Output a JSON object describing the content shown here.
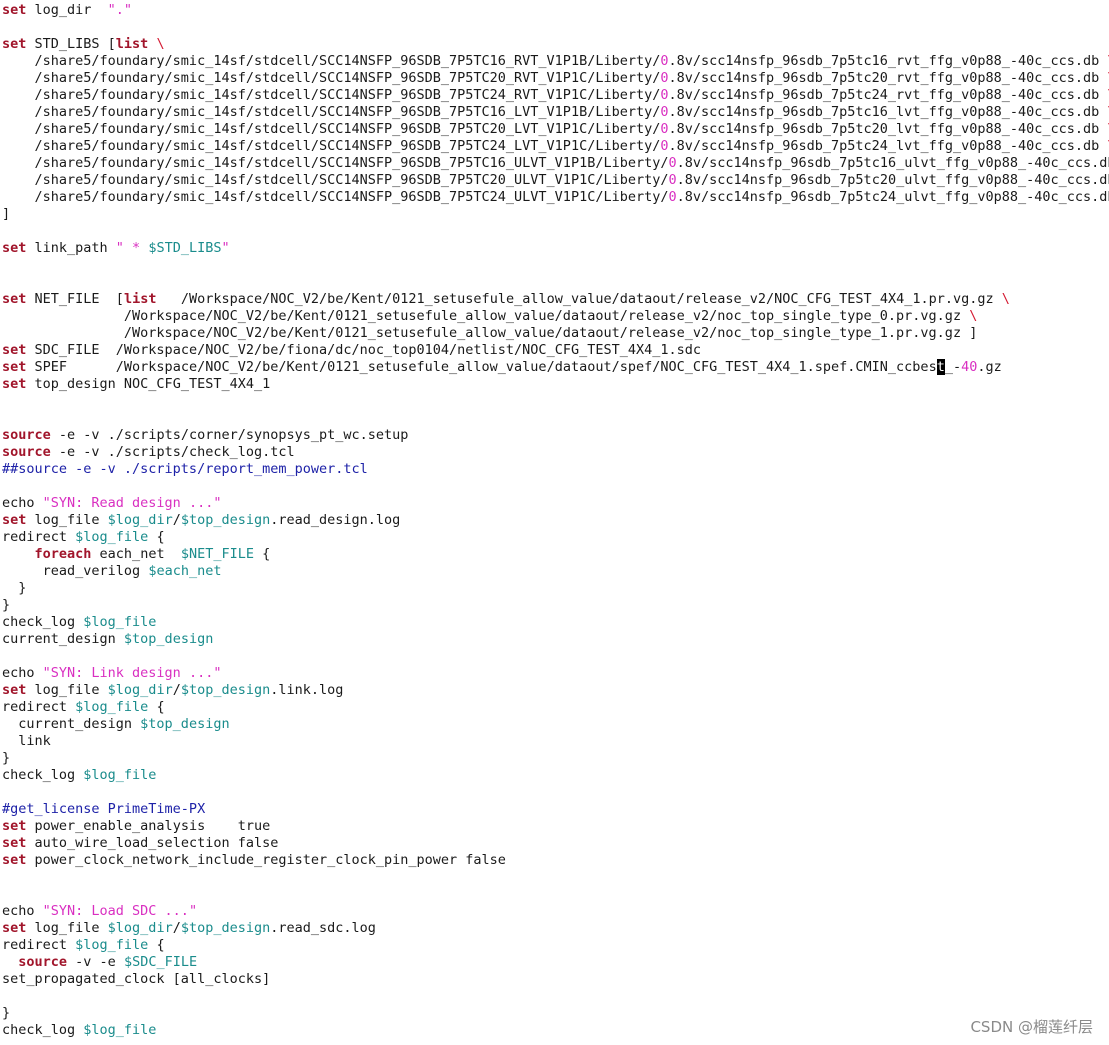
{
  "editor": {
    "lines": [
      [
        [
          "kw",
          "set"
        ],
        [
          "t",
          " log_dir  "
        ],
        [
          "str",
          "\".\""
        ]
      ],
      [],
      [
        [
          "kw",
          "set"
        ],
        [
          "t",
          " STD_LIBS ["
        ],
        [
          "kw",
          "list"
        ],
        [
          "t",
          " "
        ],
        [
          "esc",
          "\\"
        ]
      ],
      [
        [
          "t",
          "    /share5/foundary/smic_14sf/stdcell/SCC14NSFP_96SDB_7P5TC16_RVT_V1P1B/Liberty/"
        ],
        [
          "num",
          "0"
        ],
        [
          "t",
          ".8v/scc14nsfp_96sdb_7p5tc16_rvt_ffg_v0p88_-40c_ccs.db "
        ],
        [
          "esc",
          "\\"
        ]
      ],
      [
        [
          "t",
          "    /share5/foundary/smic_14sf/stdcell/SCC14NSFP_96SDB_7P5TC20_RVT_V1P1C/Liberty/"
        ],
        [
          "num",
          "0"
        ],
        [
          "t",
          ".8v/scc14nsfp_96sdb_7p5tc20_rvt_ffg_v0p88_-40c_ccs.db "
        ],
        [
          "esc",
          "\\"
        ]
      ],
      [
        [
          "t",
          "    /share5/foundary/smic_14sf/stdcell/SCC14NSFP_96SDB_7P5TC24_RVT_V1P1C/Liberty/"
        ],
        [
          "num",
          "0"
        ],
        [
          "t",
          ".8v/scc14nsfp_96sdb_7p5tc24_rvt_ffg_v0p88_-40c_ccs.db "
        ],
        [
          "esc",
          "\\"
        ]
      ],
      [
        [
          "t",
          "    /share5/foundary/smic_14sf/stdcell/SCC14NSFP_96SDB_7P5TC16_LVT_V1P1B/Liberty/"
        ],
        [
          "num",
          "0"
        ],
        [
          "t",
          ".8v/scc14nsfp_96sdb_7p5tc16_lvt_ffg_v0p88_-40c_ccs.db "
        ],
        [
          "esc",
          "\\"
        ]
      ],
      [
        [
          "t",
          "    /share5/foundary/smic_14sf/stdcell/SCC14NSFP_96SDB_7P5TC20_LVT_V1P1C/Liberty/"
        ],
        [
          "num",
          "0"
        ],
        [
          "t",
          ".8v/scc14nsfp_96sdb_7p5tc20_lvt_ffg_v0p88_-40c_ccs.db "
        ],
        [
          "esc",
          "\\"
        ]
      ],
      [
        [
          "t",
          "    /share5/foundary/smic_14sf/stdcell/SCC14NSFP_96SDB_7P5TC24_LVT_V1P1C/Liberty/"
        ],
        [
          "num",
          "0"
        ],
        [
          "t",
          ".8v/scc14nsfp_96sdb_7p5tc24_lvt_ffg_v0p88_-40c_ccs.db "
        ],
        [
          "esc",
          "\\"
        ]
      ],
      [
        [
          "t",
          "    /share5/foundary/smic_14sf/stdcell/SCC14NSFP_96SDB_7P5TC16_ULVT_V1P1B/Liberty/"
        ],
        [
          "num",
          "0"
        ],
        [
          "t",
          ".8v/scc14nsfp_96sdb_7p5tc16_ulvt_ffg_v0p88_-40c_ccs.db "
        ],
        [
          "esc",
          "\\"
        ]
      ],
      [
        [
          "t",
          "    /share5/foundary/smic_14sf/stdcell/SCC14NSFP_96SDB_7P5TC20_ULVT_V1P1C/Liberty/"
        ],
        [
          "num",
          "0"
        ],
        [
          "t",
          ".8v/scc14nsfp_96sdb_7p5tc20_ulvt_ffg_v0p88_-40c_ccs.db "
        ],
        [
          "esc",
          "\\"
        ]
      ],
      [
        [
          "t",
          "    /share5/foundary/smic_14sf/stdcell/SCC14NSFP_96SDB_7P5TC24_ULVT_V1P1C/Liberty/"
        ],
        [
          "num",
          "0"
        ],
        [
          "t",
          ".8v/scc14nsfp_96sdb_7p5tc24_ulvt_ffg_v0p88_-40c_ccs.db "
        ],
        [
          "esc",
          "\\"
        ]
      ],
      [
        [
          "t",
          "]"
        ]
      ],
      [],
      [
        [
          "kw",
          "set"
        ],
        [
          "t",
          " link_path "
        ],
        [
          "str",
          "\" * "
        ],
        [
          "var",
          "$STD_LIBS"
        ],
        [
          "str",
          "\""
        ]
      ],
      [],
      [],
      [
        [
          "kw",
          "set"
        ],
        [
          "t",
          " NET_FILE  ["
        ],
        [
          "kw",
          "list"
        ],
        [
          "t",
          "   /Workspace/NOC_V2/be/Kent/0121_setusefule_allow_value/dataout/release_v2/NOC_CFG_TEST_4X4_1.pr.vg.gz "
        ],
        [
          "esc",
          "\\"
        ]
      ],
      [
        [
          "t",
          "               /Workspace/NOC_V2/be/Kent/0121_setusefule_allow_value/dataout/release_v2/noc_top_single_type_0.pr.vg.gz "
        ],
        [
          "esc",
          "\\"
        ]
      ],
      [
        [
          "t",
          "               /Workspace/NOC_V2/be/Kent/0121_setusefule_allow_value/dataout/release_v2/noc_top_single_type_1.pr.vg.gz ]"
        ]
      ],
      [
        [
          "kw",
          "set"
        ],
        [
          "t",
          " SDC_FILE  /Workspace/NOC_V2/be/fiona/dc/noc_top0104/netlist/NOC_CFG_TEST_4X4_1.sdc"
        ]
      ],
      [
        [
          "kw",
          "set"
        ],
        [
          "t",
          " SPEF      /Workspace/NOC_V2/be/Kent/0121_setusefule_allow_value/dataout/spef/NOC_CFG_TEST_4X4_1.spef.CMIN_ccbes"
        ],
        [
          "cursor",
          "t"
        ],
        [
          "t",
          "_-"
        ],
        [
          "num",
          "40"
        ],
        [
          "t",
          ".gz"
        ]
      ],
      [
        [
          "kw",
          "set"
        ],
        [
          "t",
          " top_design NOC_CFG_TEST_4X4_1"
        ]
      ],
      [],
      [],
      [
        [
          "kw",
          "source"
        ],
        [
          "t",
          " -e -v ./scripts/corner/synopsys_pt_wc.setup"
        ]
      ],
      [
        [
          "kw",
          "source"
        ],
        [
          "t",
          " -e -v ./scripts/check_log.tcl"
        ]
      ],
      [
        [
          "cmt",
          "##source -e -v ./scripts/report_mem_power.tcl"
        ]
      ],
      [],
      [
        [
          "t",
          "echo "
        ],
        [
          "str",
          "\"SYN: Read design ...\""
        ]
      ],
      [
        [
          "kw",
          "set"
        ],
        [
          "t",
          " log_file "
        ],
        [
          "var",
          "$log_dir"
        ],
        [
          "t",
          "/"
        ],
        [
          "var",
          "$top_design"
        ],
        [
          "t",
          ".read_design.log"
        ]
      ],
      [
        [
          "t",
          "redirect "
        ],
        [
          "var",
          "$log_file"
        ],
        [
          "t",
          " {"
        ]
      ],
      [
        [
          "t",
          "    "
        ],
        [
          "kw",
          "foreach"
        ],
        [
          "t",
          " each_net  "
        ],
        [
          "var",
          "$NET_FILE"
        ],
        [
          "t",
          " {"
        ]
      ],
      [
        [
          "t",
          "     read_verilog "
        ],
        [
          "var",
          "$each_net"
        ]
      ],
      [
        [
          "t",
          "  }"
        ]
      ],
      [
        [
          "t",
          "}"
        ]
      ],
      [
        [
          "t",
          "check_log "
        ],
        [
          "var",
          "$log_file"
        ]
      ],
      [
        [
          "t",
          "current_design "
        ],
        [
          "var",
          "$top_design"
        ]
      ],
      [],
      [
        [
          "t",
          "echo "
        ],
        [
          "str",
          "\"SYN: Link design ...\""
        ]
      ],
      [
        [
          "kw",
          "set"
        ],
        [
          "t",
          " log_file "
        ],
        [
          "var",
          "$log_dir"
        ],
        [
          "t",
          "/"
        ],
        [
          "var",
          "$top_design"
        ],
        [
          "t",
          ".link.log"
        ]
      ],
      [
        [
          "t",
          "redirect "
        ],
        [
          "var",
          "$log_file"
        ],
        [
          "t",
          " {"
        ]
      ],
      [
        [
          "t",
          "  current_design "
        ],
        [
          "var",
          "$top_design"
        ]
      ],
      [
        [
          "t",
          "  link"
        ]
      ],
      [
        [
          "t",
          "}"
        ]
      ],
      [
        [
          "t",
          "check_log "
        ],
        [
          "var",
          "$log_file"
        ]
      ],
      [],
      [
        [
          "cmt",
          "#get_license PrimeTime-PX"
        ]
      ],
      [
        [
          "kw",
          "set"
        ],
        [
          "t",
          " power_enable_analysis    true"
        ]
      ],
      [
        [
          "kw",
          "set"
        ],
        [
          "t",
          " auto_wire_load_selection false"
        ]
      ],
      [
        [
          "kw",
          "set"
        ],
        [
          "t",
          " power_clock_network_include_register_clock_pin_power false"
        ]
      ],
      [],
      [],
      [
        [
          "t",
          "echo "
        ],
        [
          "str",
          "\"SYN: Load SDC ...\""
        ]
      ],
      [
        [
          "kw",
          "set"
        ],
        [
          "t",
          " log_file "
        ],
        [
          "var",
          "$log_dir"
        ],
        [
          "t",
          "/"
        ],
        [
          "var",
          "$top_design"
        ],
        [
          "t",
          ".read_sdc.log"
        ]
      ],
      [
        [
          "t",
          "redirect "
        ],
        [
          "var",
          "$log_file"
        ],
        [
          "t",
          " {"
        ]
      ],
      [
        [
          "t",
          "  "
        ],
        [
          "kw",
          "source"
        ],
        [
          "t",
          " -v -e "
        ],
        [
          "var",
          "$SDC_FILE"
        ]
      ],
      [
        [
          "t",
          "set_propagated_clock [all_clocks]"
        ]
      ],
      [],
      [
        [
          "t",
          "}"
        ]
      ],
      [
        [
          "t",
          "check_log "
        ],
        [
          "var",
          "$log_file"
        ]
      ]
    ]
  },
  "watermark": {
    "text": "CSDN @榴莲纤层"
  }
}
